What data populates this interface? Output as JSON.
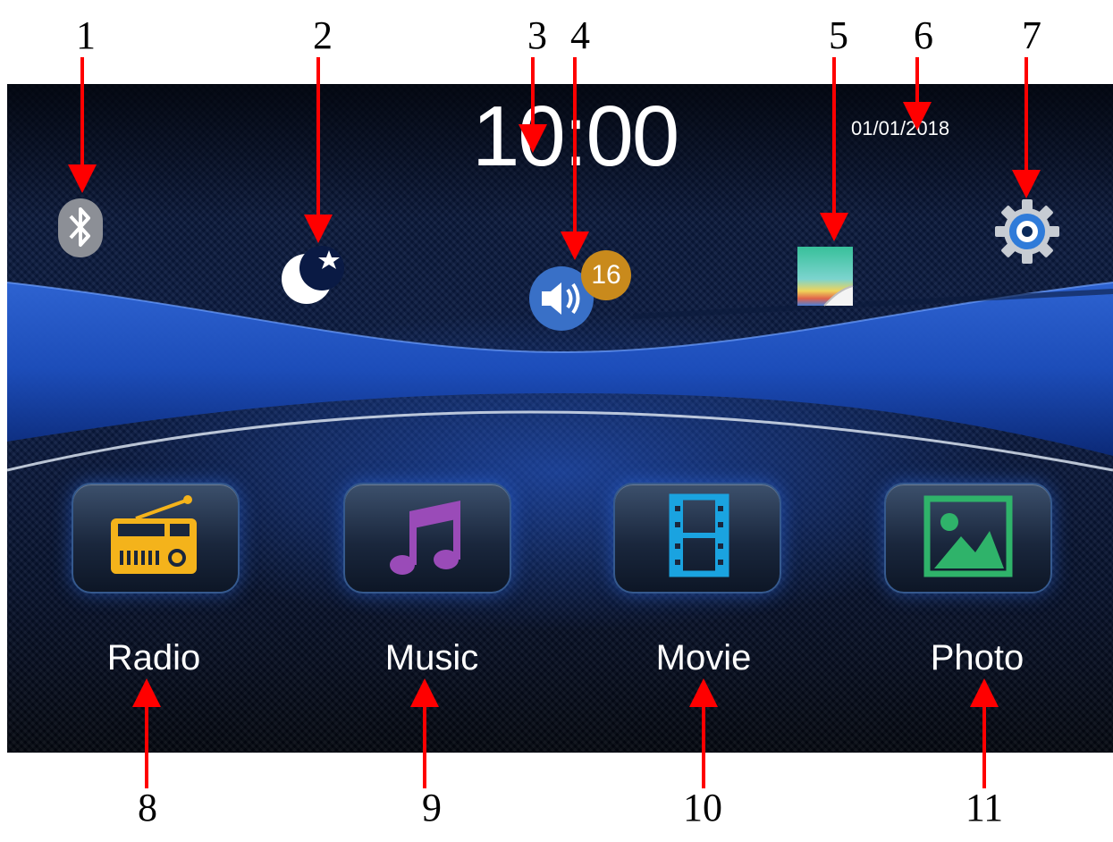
{
  "callouts": [
    "1",
    "2",
    "3",
    "4",
    "5",
    "6",
    "7",
    "8",
    "9",
    "10",
    "11"
  ],
  "status_bar": {
    "time": "10:00",
    "date": "01/01/2018",
    "volume_level": "16",
    "icons": [
      "bluetooth-icon",
      "night-mode-icon",
      "volume-icon",
      "wallpaper-icon",
      "settings-icon"
    ]
  },
  "apps": [
    {
      "label": "Radio",
      "icon": "radio-icon",
      "color": "#f4b31b"
    },
    {
      "label": "Music",
      "icon": "music-note-icon",
      "color": "#9a4bb8"
    },
    {
      "label": "Movie",
      "icon": "film-icon",
      "color": "#1aa3e0"
    },
    {
      "label": "Photo",
      "icon": "image-icon",
      "color": "#2fb36a"
    }
  ],
  "colors": {
    "arrow": "#ff0000",
    "screen_background": "#0a1633",
    "badge": "#c98a1c"
  }
}
